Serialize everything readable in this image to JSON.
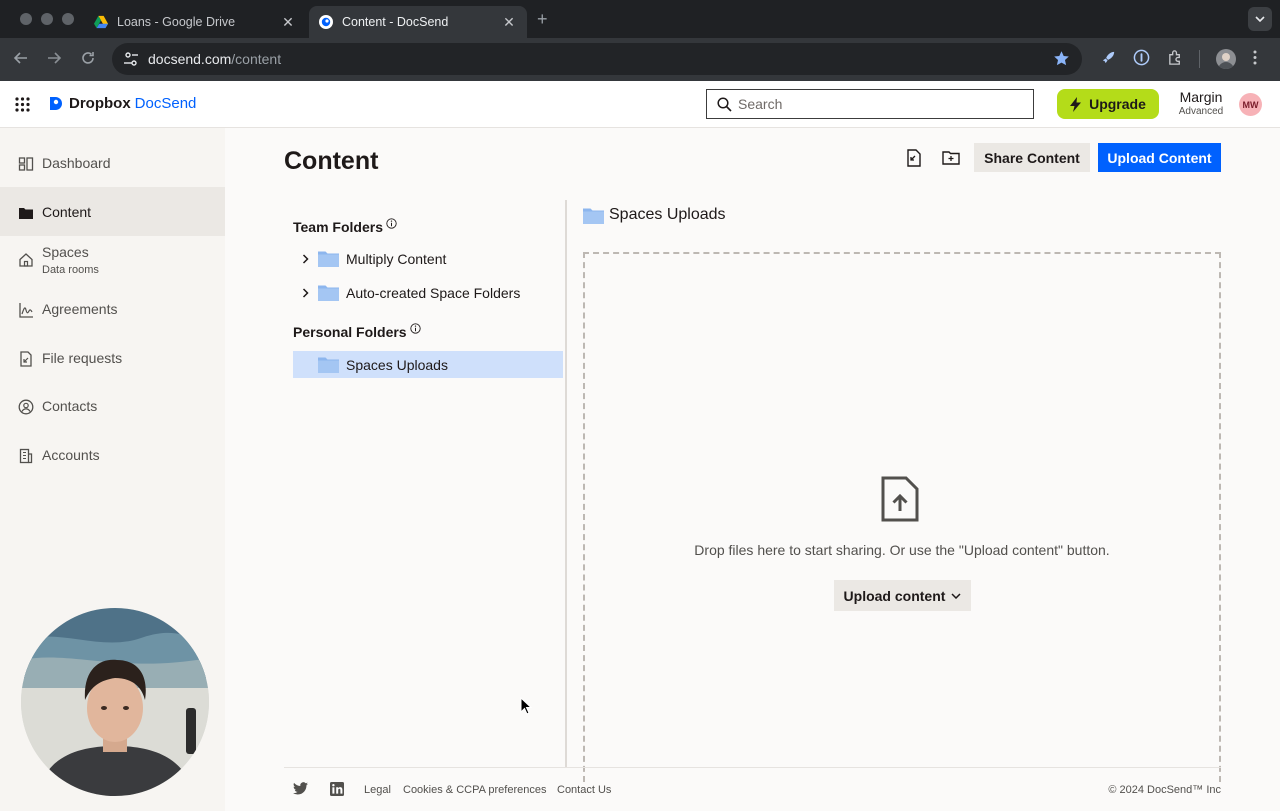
{
  "browser": {
    "tabs": [
      {
        "title": "Loans - Google Drive",
        "icon": "google-drive-icon",
        "active": false
      },
      {
        "title": "Content - DocSend",
        "icon": "docsend-icon",
        "active": true
      }
    ],
    "url_host": "docsend.com",
    "url_path": "/content"
  },
  "header": {
    "brand_primary": "Dropbox",
    "brand_secondary": "DocSend",
    "search_placeholder": "Search",
    "upgrade_label": "Upgrade",
    "account_name": "Margin",
    "account_plan": "Advanced",
    "avatar_initials": "MW",
    "accent": "#0061fe",
    "upgrade_color": "#b4dc19"
  },
  "sidebar": {
    "items": [
      {
        "label": "Dashboard",
        "icon": "dashboard-icon"
      },
      {
        "label": "Content",
        "icon": "folder-icon",
        "active": true
      },
      {
        "label": "Spaces",
        "sublabel": "Data rooms",
        "icon": "home-icon"
      },
      {
        "label": "Agreements",
        "icon": "signature-icon"
      },
      {
        "label": "File requests",
        "icon": "file-request-icon"
      },
      {
        "label": "Contacts",
        "icon": "contact-icon"
      },
      {
        "label": "Accounts",
        "icon": "building-icon"
      }
    ]
  },
  "main": {
    "title": "Content",
    "share_label": "Share Content",
    "upload_label": "Upload Content",
    "team_folders_heading": "Team Folders",
    "team_folders": [
      "Multiply Content",
      "Auto-created Space Folders"
    ],
    "personal_folders_heading": "Personal Folders",
    "personal_folders": [
      "Spaces Uploads"
    ],
    "current_folder": "Spaces Uploads",
    "dropzone_text": "Drop files here to start sharing. Or use the \"Upload content\" button.",
    "dropzone_button": "Upload content"
  },
  "footer": {
    "links": [
      "Legal",
      "Cookies & CCPA preferences",
      "Contact Us"
    ],
    "copyright": "© 2024 DocSend™ Inc",
    "social": [
      "twitter-icon",
      "linkedin-icon"
    ]
  }
}
